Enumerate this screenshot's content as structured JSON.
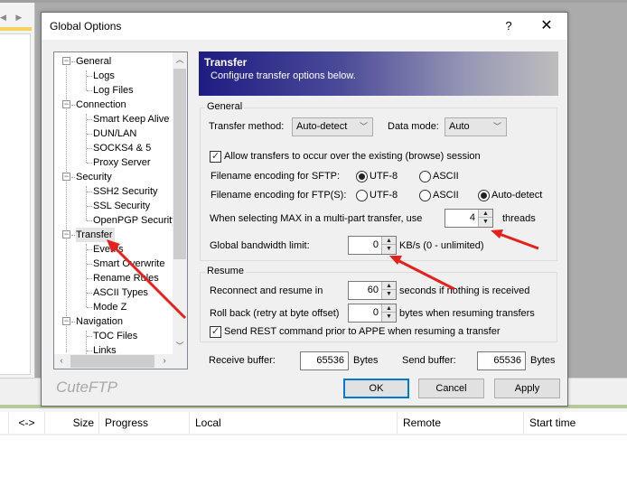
{
  "background": {
    "queue_columns": [
      "<->",
      "Size",
      "Progress",
      "Local",
      "Remote",
      "Start time"
    ]
  },
  "dialog": {
    "title": "Global Options",
    "help_label": "?",
    "close_label": "✕",
    "brand": "CuteFTP",
    "tree": {
      "groups": [
        {
          "label": "General",
          "children": [
            "Logs",
            "Log Files"
          ]
        },
        {
          "label": "Connection",
          "children": [
            "Smart Keep Alive",
            "DUN/LAN",
            "SOCKS4 & 5",
            "Proxy Server"
          ]
        },
        {
          "label": "Security",
          "children": [
            "SSH2 Security",
            "SSL Security",
            "OpenPGP Security"
          ]
        },
        {
          "label": "Transfer",
          "children": [
            "Events",
            "Smart Overwrite",
            "Rename Rules",
            "ASCII Types",
            "Mode Z"
          ]
        },
        {
          "label": "Navigation",
          "children": [
            "TOC Files",
            "Links"
          ]
        }
      ],
      "selected": "Transfer"
    },
    "banner": {
      "title": "Transfer",
      "subtitle": "Configure transfer options below."
    },
    "general": {
      "label": "General",
      "transfer_method_label": "Transfer method:",
      "transfer_method_value": "Auto-detect",
      "data_mode_label": "Data mode:",
      "data_mode_value": "Auto",
      "allow_existing_session_label": "Allow transfers to occur over the existing (browse) session",
      "allow_existing_session_checked": true,
      "sftp_encoding_label": "Filename encoding for SFTP:",
      "sftp_options": [
        "UTF-8",
        "ASCII"
      ],
      "sftp_selected": "UTF-8",
      "ftp_encoding_label": "Filename encoding for FTP(S):",
      "ftp_options": [
        "UTF-8",
        "ASCII",
        "Auto-detect"
      ],
      "ftp_selected": "Auto-detect",
      "max_threads_label": "When selecting MAX in a multi-part transfer, use",
      "max_threads_value": "4",
      "max_threads_unit": "threads",
      "bandwidth_label": "Global bandwidth limit:",
      "bandwidth_value": "0",
      "bandwidth_unit": "KB/s (0 - unlimited)"
    },
    "resume": {
      "label": "Resume",
      "reconnect_label": "Reconnect and resume in",
      "reconnect_value": "60",
      "reconnect_unit": "seconds if nothing is received",
      "rollback_label": "Roll back (retry at byte offset)",
      "rollback_value": "0",
      "rollback_unit": "bytes when resuming transfers",
      "send_rest_label": "Send REST command prior to APPE when resuming a transfer",
      "send_rest_checked": true
    },
    "buffers": {
      "receive_label": "Receive buffer:",
      "receive_value": "65536",
      "receive_unit": "Bytes",
      "send_label": "Send buffer:",
      "send_value": "65536",
      "send_unit": "Bytes"
    },
    "buttons": {
      "ok": "OK",
      "cancel": "Cancel",
      "apply": "Apply"
    }
  },
  "annotations": {
    "arrow_color": "#e8201c"
  }
}
